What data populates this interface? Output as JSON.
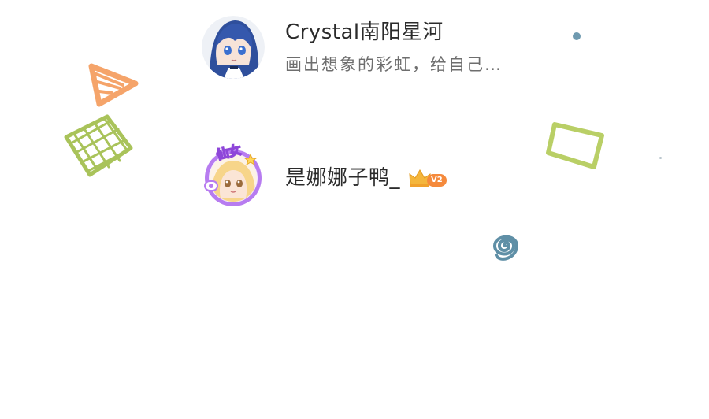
{
  "users": [
    {
      "username": "Crystal南阳星河",
      "bio": "画出想象的彩虹，给自己…",
      "avatar_icon": "anime-girl-blue-hair-avatar"
    },
    {
      "username": "是娜娜子鸭_",
      "vip_level": "V2",
      "avatar_icon": "anime-girl-purple-frame-avatar",
      "avatar_frame_text": "仙女"
    }
  ],
  "decorations": {
    "colors": {
      "orange": "#f5a46a",
      "green": "#a9c35a",
      "lime": "#b9cf66",
      "teal": "#5f8fa6",
      "dot": "#6f9ab0",
      "vip": "#f58a3c",
      "crown": "#f4b63c"
    }
  }
}
